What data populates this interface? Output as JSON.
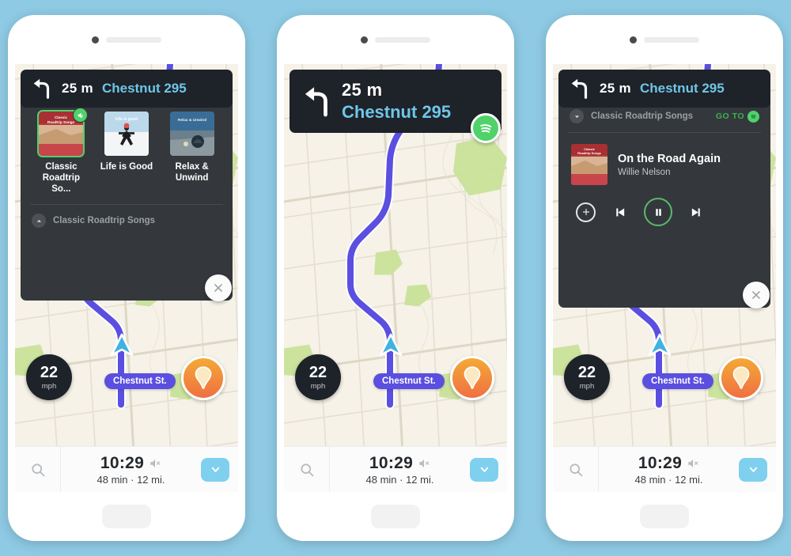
{
  "background_color": "#8ecae4",
  "nav": {
    "distance": "25 m",
    "street": "Chestnut 295",
    "turn_icon": "turn-left-arrow-icon"
  },
  "playlists": [
    {
      "label": "Classic\nRoadtrip So...",
      "label_line1": "Classic",
      "label_line2": "Roadtrip So...",
      "selected": true,
      "art_title": "Classic Roadtrip Songs"
    },
    {
      "label": "Life is Good",
      "label_line1": "Life is Good",
      "label_line2": "",
      "selected": false,
      "art_title": "Life is good"
    },
    {
      "label": "Relax &\nUnwind",
      "label_line1": "Relax &",
      "label_line2": "Unwind",
      "selected": false,
      "art_title": "Relax & Unwind"
    }
  ],
  "now_playing_bar": {
    "title": "Classic Roadtrip Songs",
    "chevron_up_icon": "chevron-up-icon"
  },
  "player": {
    "playlist_title": "Classic Roadtrip Songs",
    "chevron_down_icon": "chevron-down-icon",
    "goto_label": "GO TO",
    "spotify_icon": "spotify-icon",
    "track_title": "On the Road Again",
    "track_artist": "Willie Nelson",
    "album_art_title": "Classic Roadtrip Songs",
    "controls": {
      "add": "add-to-playlist-icon",
      "previous": "skip-previous-icon",
      "play_pause": "pause-icon",
      "next": "skip-next-icon"
    },
    "accent_color": "#4fd26a"
  },
  "map": {
    "speed": {
      "value": "22",
      "unit": "mph"
    },
    "street_label": "Chestnut St.",
    "route_color": "#5b4fe0",
    "destination_pin_icon": "destination-pin-icon",
    "car_marker_icon": "navigation-arrow-icon"
  },
  "eta_bar": {
    "search_icon": "search-icon",
    "time": "10:29",
    "mute_icon": "volume-mute-icon",
    "summary": "48 min · 12 mi.",
    "expand_icon": "chevron-down-icon",
    "expand_color": "#7fd0ef"
  },
  "close_button": {
    "icon": "close-icon"
  },
  "phones": [
    {
      "id": "phone-playlist-picker",
      "state": "playlist-picker"
    },
    {
      "id": "phone-navigation",
      "state": "navigation-only"
    },
    {
      "id": "phone-player",
      "state": "now-playing"
    }
  ]
}
